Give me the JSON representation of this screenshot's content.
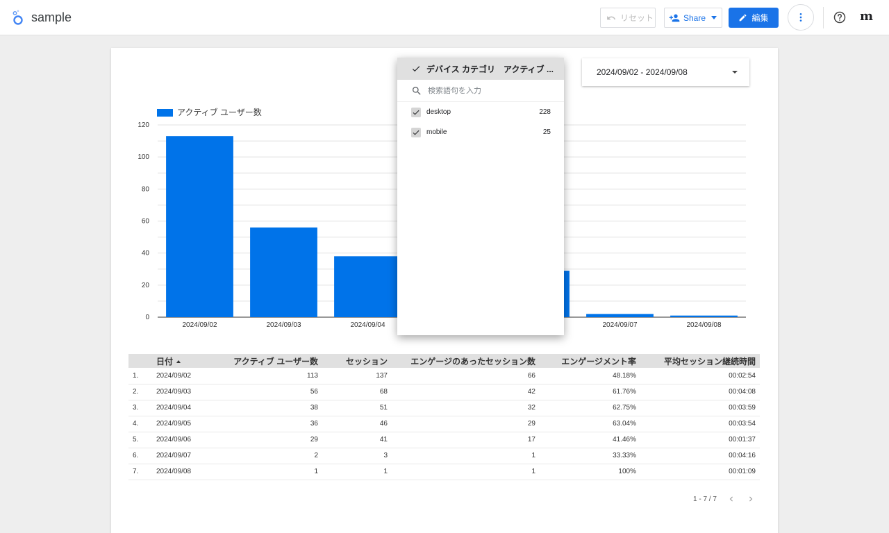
{
  "header": {
    "title": "sample",
    "reset_label": "リセット",
    "share_label": "Share",
    "edit_label": "編集",
    "avatar_letter": "m",
    "icons": [
      "looker-studio-logo-icon",
      "undo-icon",
      "person-add-icon",
      "chevron-down-icon",
      "pencil-icon",
      "more-vert-icon",
      "help-icon"
    ]
  },
  "date_range": {
    "value": "2024/09/02 - 2024/09/08"
  },
  "dropdown": {
    "header_label": "デバイス カテゴリ　アクティブ ...",
    "search_placeholder": "検索語句を入力",
    "items": [
      {
        "label": "desktop",
        "count": "228",
        "checked": true
      },
      {
        "label": "mobile",
        "count": "25",
        "checked": true
      }
    ]
  },
  "chart_data": {
    "type": "bar",
    "categories": [
      "2024/09/02",
      "2024/09/03",
      "2024/09/04",
      "2024/09/05",
      "2024/09/06",
      "2024/09/07",
      "2024/09/08"
    ],
    "series": [
      {
        "name": "アクティブ ユーザー数",
        "values": [
          113,
          56,
          38,
          36,
          29,
          2,
          1
        ],
        "color": "#0073e9"
      }
    ],
    "ylim": [
      0,
      120
    ],
    "yticks": [
      0,
      20,
      40,
      60,
      80,
      100,
      120
    ],
    "grid": true,
    "legend": "top-left"
  },
  "table": {
    "columns": [
      "日付",
      "アクティブ ユーザー数",
      "セッション",
      "エンゲージのあったセッション数",
      "エンゲージメント率",
      "平均セッション継続時間"
    ],
    "rows": [
      [
        "1.",
        "2024/09/02",
        "113",
        "137",
        "66",
        "48.18%",
        "00:02:54"
      ],
      [
        "2.",
        "2024/09/03",
        "56",
        "68",
        "42",
        "61.76%",
        "00:04:08"
      ],
      [
        "3.",
        "2024/09/04",
        "38",
        "51",
        "32",
        "62.75%",
        "00:03:59"
      ],
      [
        "4.",
        "2024/09/05",
        "36",
        "46",
        "29",
        "63.04%",
        "00:03:54"
      ],
      [
        "5.",
        "2024/09/06",
        "29",
        "41",
        "17",
        "41.46%",
        "00:01:37"
      ],
      [
        "6.",
        "2024/09/07",
        "2",
        "3",
        "1",
        "33.33%",
        "00:04:16"
      ],
      [
        "7.",
        "2024/09/08",
        "1",
        "1",
        "1",
        "100%",
        "00:01:09"
      ]
    ],
    "pagination": "1 - 7 / 7"
  }
}
